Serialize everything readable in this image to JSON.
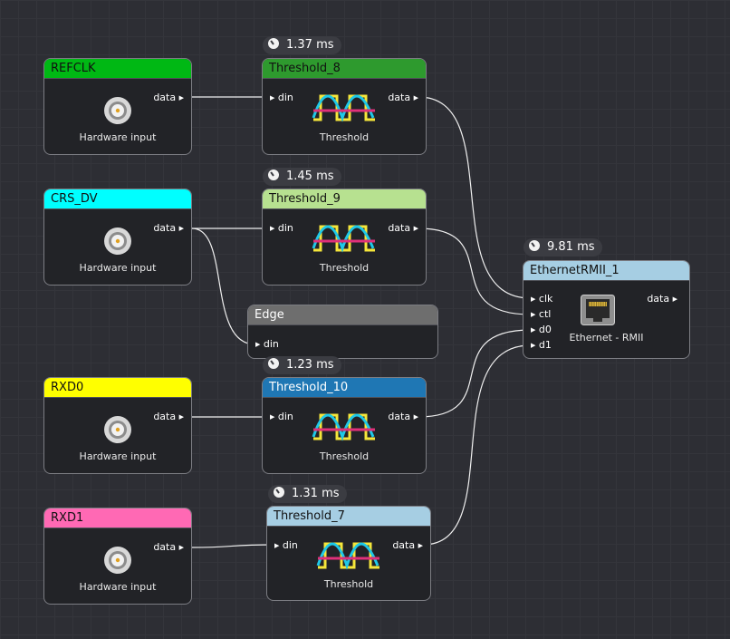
{
  "nodes": {
    "refclk": {
      "title": "REFCLK",
      "out": "data",
      "caption": "Hardware input",
      "color": "#00b814"
    },
    "crs_dv": {
      "title": "CRS_DV",
      "out": "data",
      "caption": "Hardware input",
      "color": "#00ffff"
    },
    "rxd0": {
      "title": "RXD0",
      "out": "data",
      "caption": "Hardware input",
      "color": "#ffff00"
    },
    "rxd1": {
      "title": "RXD1",
      "out": "data",
      "caption": "Hardware input",
      "color": "#ff69b4"
    },
    "threshold_8": {
      "title": "Threshold_8",
      "in": "din",
      "out": "data",
      "caption": "Threshold",
      "timing": "1.37 ms",
      "color": "#2e9a2e"
    },
    "threshold_9": {
      "title": "Threshold_9",
      "in": "din",
      "out": "data",
      "caption": "Threshold",
      "timing": "1.45 ms",
      "color": "#b7e190"
    },
    "threshold_10": {
      "title": "Threshold_10",
      "in": "din",
      "out": "data",
      "caption": "Threshold",
      "timing": "1.23 ms",
      "color": "#1f77b4"
    },
    "threshold_7": {
      "title": "Threshold_7",
      "in": "din",
      "out": "data",
      "caption": "Threshold",
      "timing": "1.31 ms",
      "color": "#a6cee3"
    },
    "edge": {
      "title": "Edge",
      "in": "din",
      "color": "#6e6e6e"
    },
    "ethernet": {
      "title": "EthernetRMII_1",
      "inputs": [
        "clk",
        "ctl",
        "d0",
        "d1"
      ],
      "out": "data",
      "caption": "Ethernet - RMII",
      "timing": "9.81 ms",
      "color": "#a6cee3"
    }
  },
  "icons": {
    "hardware_input": "bnc-connector-icon",
    "threshold": "threshold-waveform-icon",
    "ethernet": "rj45-port-icon",
    "timing": "clock-icon"
  },
  "colors": {
    "wire": "#f0f0f0",
    "background": "#2d2e34",
    "node_body": "#222327"
  }
}
